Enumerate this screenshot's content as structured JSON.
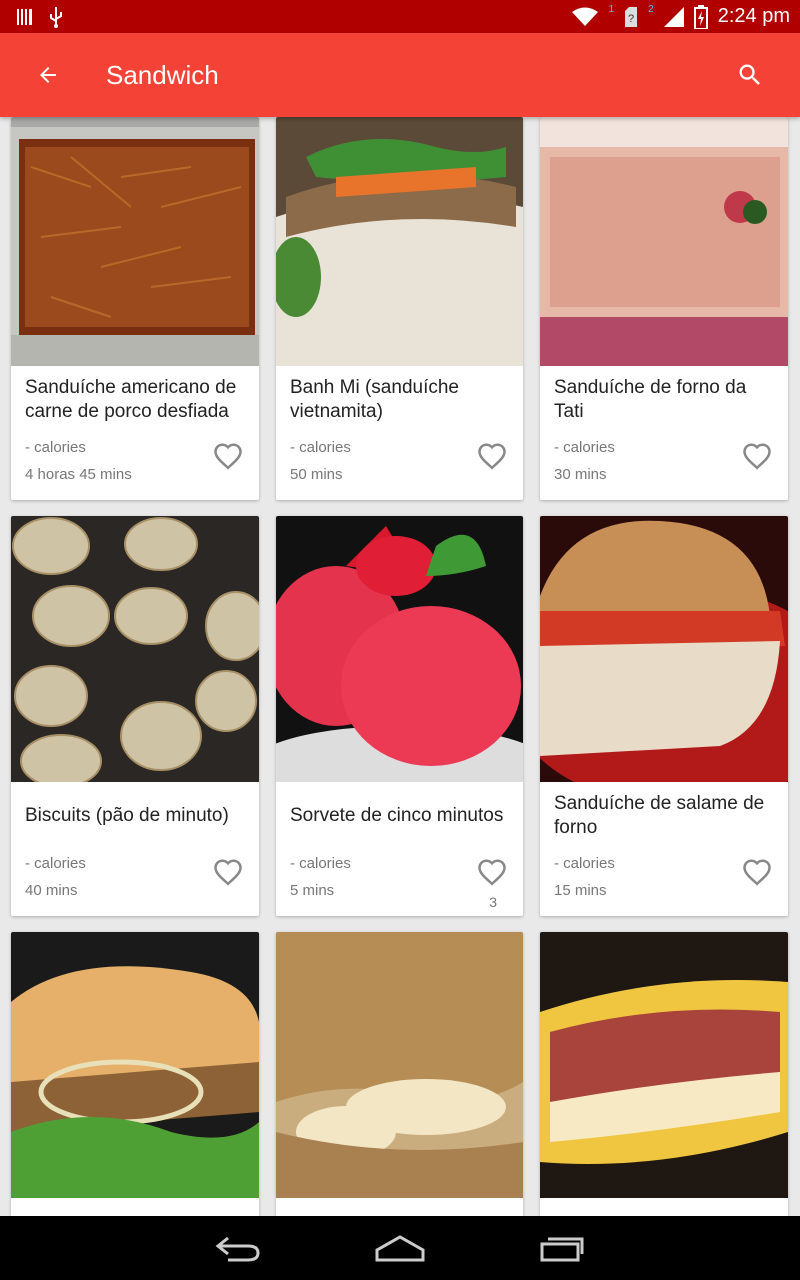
{
  "status_bar": {
    "time": "2:24 pm",
    "sim1": "1",
    "sim2": "2",
    "icons": [
      "barcode-icon",
      "usb-icon",
      "wifi-icon",
      "sim-unknown-icon",
      "signal-icon",
      "battery-charging-icon"
    ]
  },
  "app_bar": {
    "title": "Sandwich",
    "back_icon": "arrow-back-icon",
    "search_icon": "search-icon",
    "color": "#f44336"
  },
  "recipes": [
    {
      "title": "Sanduíche americano de carne de porco desfiada",
      "calories": "- calories",
      "time": "4 horas 45 mins",
      "likes": ""
    },
    {
      "title": "Banh Mi (sanduíche vietnamita)",
      "calories": "- calories",
      "time": "50 mins",
      "likes": ""
    },
    {
      "title": "Sanduíche de forno da Tati",
      "calories": "- calories",
      "time": "30 mins",
      "likes": ""
    },
    {
      "title": "Biscuits (pão de minuto)",
      "calories": "- calories",
      "time": "40 mins",
      "likes": ""
    },
    {
      "title": "Sorvete de cinco minutos",
      "calories": "- calories",
      "time": "5 mins",
      "likes": "3"
    },
    {
      "title": "Sanduíche de salame de forno",
      "calories": "- calories",
      "time": "15 mins",
      "likes": ""
    },
    {
      "title": "",
      "calories": "",
      "time": "",
      "likes": ""
    },
    {
      "title": "",
      "calories": "",
      "time": "",
      "likes": ""
    },
    {
      "title": "",
      "calories": "",
      "time": "",
      "likes": ""
    }
  ],
  "nav_bar": {
    "icons": [
      "back-nav-icon",
      "home-nav-icon",
      "recents-nav-icon"
    ]
  }
}
